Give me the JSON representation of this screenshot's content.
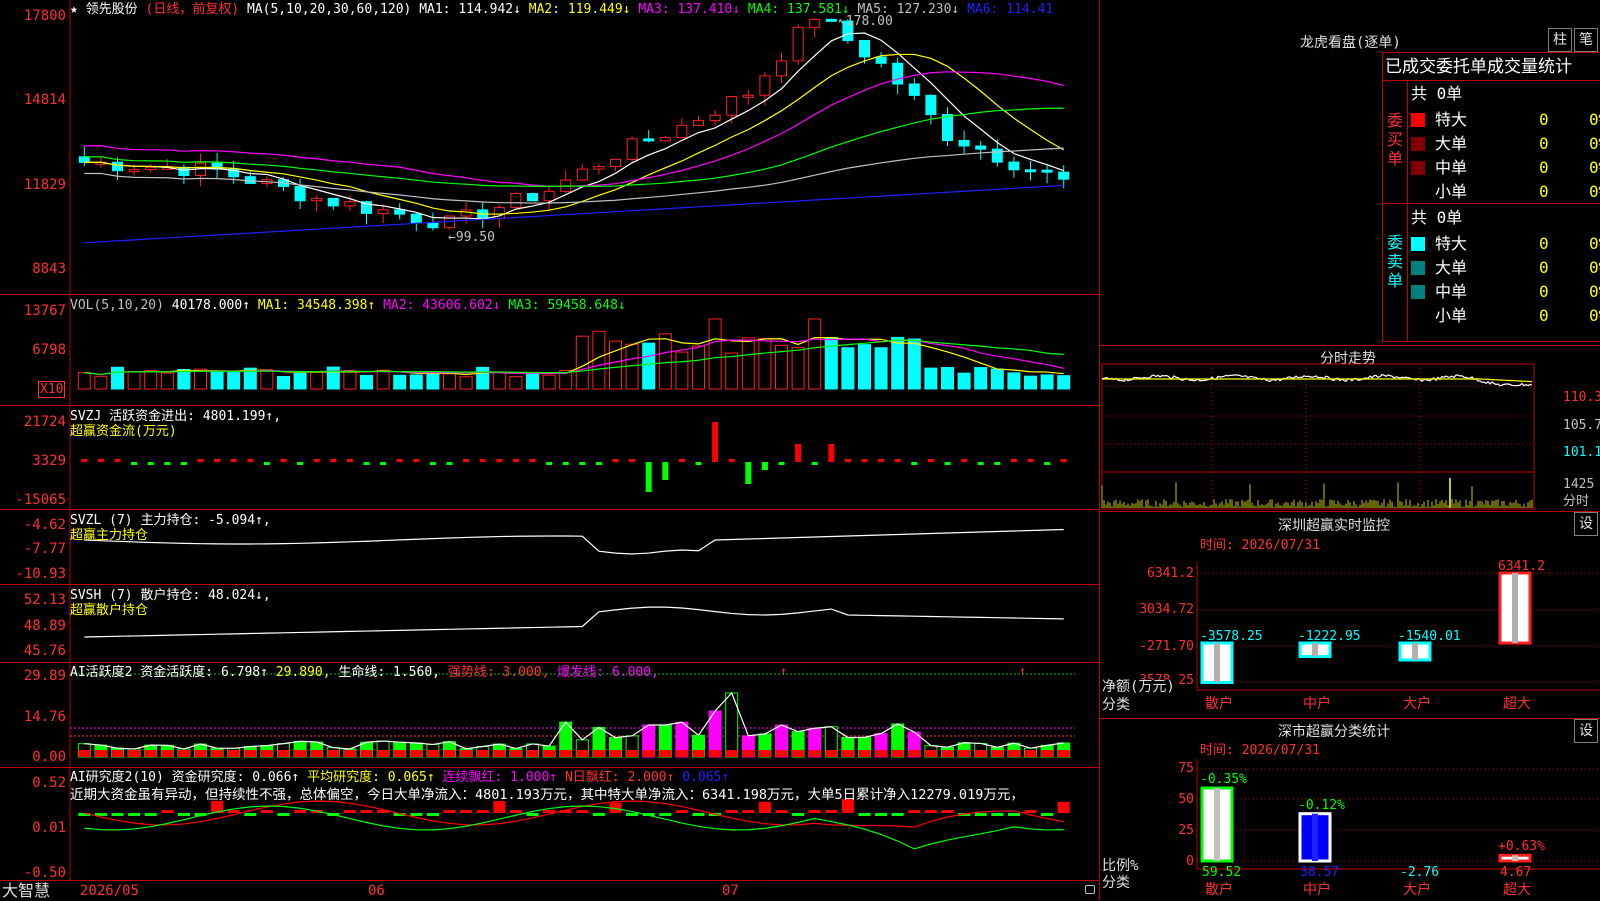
{
  "main": {
    "title_prefix": "★",
    "stock_name": "领先股份",
    "period": "(日线，前复权)",
    "ma_label": "MA(5,10,20,30,60,120)",
    "ma1": "MA1: 114.942↓",
    "ma2": "MA2: 119.449↓",
    "ma3": "MA3: 137.410↓",
    "ma4": "MA4: 137.581↓",
    "ma5": "MA5: 127.230↓",
    "ma6": "MA6: 114.41",
    "high_mark": "178.00",
    "low_mark": "99.50",
    "y_labels": [
      "17800",
      "14814",
      "11829",
      "8843"
    ]
  },
  "vol": {
    "title": "VOL(5,10,20)",
    "value": "40178.000↑",
    "ma1": "MA1: 34548.398↑",
    "ma2": "MA2: 43606.602↓",
    "ma3": "MA3: 59458.648↓",
    "y_labels": [
      "13767",
      "6798"
    ],
    "unit": "X10"
  },
  "svzj": {
    "title": "SVZJ  活跃资金进出: 4801.199↑,",
    "subtitle": "超赢资金流(万元)",
    "y_labels": [
      "21724",
      "3329",
      "-15065"
    ]
  },
  "svzl": {
    "title": "SVZL (7) 主力持仓: -5.094↑,",
    "subtitle": "超赢主力持仓",
    "y_labels": [
      "-4.62",
      "-7.77",
      "-10.93"
    ]
  },
  "svsh": {
    "title": "SVSH (7) 散户持仓: 48.024↓,",
    "subtitle": "超赢散户持仓",
    "y_labels": [
      "52.13",
      "48.89",
      "45.76"
    ]
  },
  "ai2": {
    "title": "AI活跃度2 资金活跃度: 6.798↑",
    "v2": "29.890,",
    "v3": "生命线: 1.560,",
    "v4": "强势线: 3.000,",
    "v5": "爆发线: 6.000,",
    "y_labels": [
      "29.89",
      "14.76",
      "0.00"
    ]
  },
  "ai3": {
    "title": "AI研究度2(10) 资金研究度: 0.066↑",
    "v2": "平均研究度: 0.065↑",
    "v3": "连续飘红: 1.000↑",
    "v4": "N日飘红: 2.000↑",
    "v5": "0.065↑",
    "comment": "近期大资金虽有异动，但持续性不强，总体偏空，今日大单净流入：4801.193万元，其中特大单净流入：6341.198万元，大单5日累计净入12279.019万元，",
    "y_labels": [
      "0.52",
      "0.01",
      "-0.50"
    ]
  },
  "bottom": {
    "brand": "大智慧",
    "dates": [
      "2026/05",
      "06",
      "07"
    ]
  },
  "lhb": {
    "title": "龙虎看盘(逐单)",
    "btn_bar": "柱",
    "btn_pen": "笔",
    "header": "已成交委托单成交量统计",
    "buy_side": "委买单",
    "sell_side": "委卖单",
    "buy_total": "共 0单",
    "sell_total": "共 0单",
    "rows": [
      {
        "label": "特大",
        "n": "0",
        "pct": "0%"
      },
      {
        "label": "大单",
        "n": "0",
        "pct": "0%"
      },
      {
        "label": "中单",
        "n": "0",
        "pct": "0%"
      },
      {
        "label": "小单",
        "n": "0",
        "pct": "0%"
      }
    ]
  },
  "intraday": {
    "title": "分时走势",
    "y_labels": [
      "110.3",
      "105.7",
      "101.1"
    ],
    "vol_label": "1425",
    "vol_unit": "分时"
  },
  "monitor": {
    "title": "深圳超赢实时监控",
    "btn": "设",
    "time": "时间: 2026/07/31",
    "y_labels": [
      "6341.2",
      "3034.72",
      "-271.70",
      "-3578.25"
    ],
    "unit": "净额(万元)",
    "axis": "分类",
    "bars": [
      {
        "cat": "散户",
        "value": "-3578.25"
      },
      {
        "cat": "中户",
        "value": "-1222.95"
      },
      {
        "cat": "大户",
        "value": "-1540.01"
      },
      {
        "cat": "超大",
        "value": "6341.2"
      }
    ]
  },
  "classify": {
    "title": "深市超赢分类统计",
    "btn": "设",
    "time": "时间: 2026/07/31",
    "y_labels": [
      "75",
      "50",
      "25",
      "0"
    ],
    "unit": "比例%",
    "axis": "分类",
    "bars": [
      {
        "cat": "散户",
        "pct": "-0.35%",
        "value": "59.52"
      },
      {
        "cat": "中户",
        "pct": "-0.12%",
        "value": "38.57"
      },
      {
        "cat": "大户",
        "pct": "",
        "value": "-2.76"
      },
      {
        "cat": "超大",
        "pct": "+0.63%",
        "value": "4.67"
      }
    ]
  },
  "colors": {
    "up": "#ff2020",
    "down": "#00ffff",
    "border": "#c00000",
    "ma1": "#ffffff",
    "ma2": "#ffff00",
    "ma3": "#ff00ff",
    "ma4": "#00ff00",
    "ma5": "#c0c0c0",
    "ma6": "#2020ff"
  }
}
